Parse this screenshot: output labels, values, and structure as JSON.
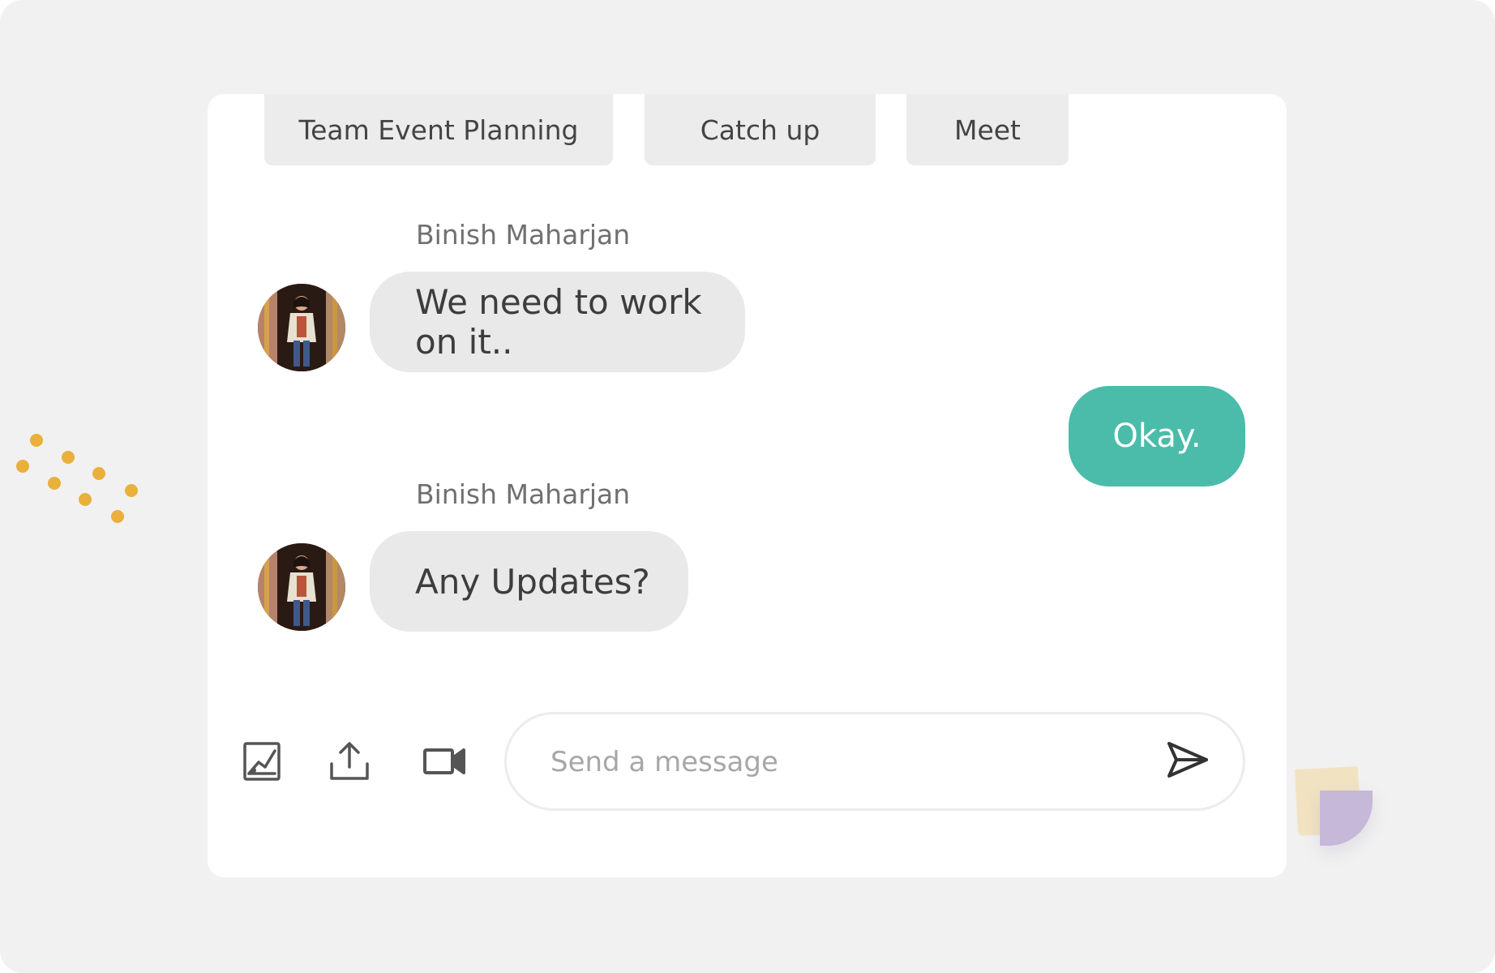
{
  "tabs": [
    {
      "label": "Team Event Planning"
    },
    {
      "label": "Catch up"
    },
    {
      "label": "Meet"
    }
  ],
  "messages": [
    {
      "sender": "Binish Maharjan",
      "text": "We need to work on it..",
      "direction": "incoming"
    },
    {
      "text": "Okay.",
      "direction": "outgoing"
    },
    {
      "sender": "Binish Maharjan",
      "text": "Any Updates?",
      "direction": "incoming"
    }
  ],
  "toolbar": {
    "image_icon": "image-icon",
    "upload_icon": "upload-icon",
    "video_icon": "video-camera-icon",
    "send_icon": "send-icon"
  },
  "composer": {
    "placeholder": "Send a message",
    "value": ""
  },
  "colors": {
    "outgoing_bubble": "#4bbcaa",
    "incoming_bubble": "#e9e9e9",
    "tab_background": "#ececec",
    "page_background": "#f1f1f1",
    "accent_dots": "#eab03c"
  }
}
